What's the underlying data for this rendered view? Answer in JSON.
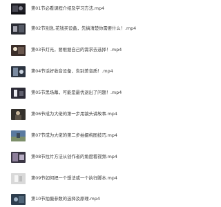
{
  "files": [
    {
      "name": "第01节必看课程介绍及学习方法.mp4",
      "icon": "video-thumbnail-icon",
      "tone": "#1d1d24"
    },
    {
      "name": "第02节别急,花钱买设备，先搞清楚你需要什么！.mp4",
      "icon": "video-thumbnail-icon",
      "tone": "#2a2c34"
    },
    {
      "name": "第03节灯光，要根据自己的需求去选择！.mp4",
      "icon": "video-thumbnail-icon",
      "tone": "#3b2e2a"
    },
    {
      "name": "第04节话好收音设备，告别差音质！.mp4",
      "icon": "video-thumbnail-icon",
      "tone": "#2c3440"
    },
    {
      "name": "第05节黑场幕，可能是最优退出了问题！.mp4",
      "icon": "video-thumbnail-icon",
      "tone": "#2b2a36"
    },
    {
      "name": "第06节成为大佬的第一步用镜头讲故事.mp4",
      "icon": "video-thumbnail-icon",
      "tone": "#34312c"
    },
    {
      "name": "第07节成为大佬的第二步拍摄构图技巧.mp4",
      "icon": "video-thumbnail-icon",
      "tone": "#5a7aa0"
    },
    {
      "name": "第08节拉片方法从创作者的角度看视频.mp4",
      "icon": "video-thumbnail-icon",
      "tone": "#3a3644"
    },
    {
      "name": "第09节如何把一个想法或一个执行脚本.mp4",
      "icon": "video-thumbnail-icon",
      "tone": "#d9d9d9"
    },
    {
      "name": "第10节拍摄参数的选择及原理.mp4",
      "icon": "video-thumbnail-icon",
      "tone": "#2e3e4e"
    }
  ]
}
